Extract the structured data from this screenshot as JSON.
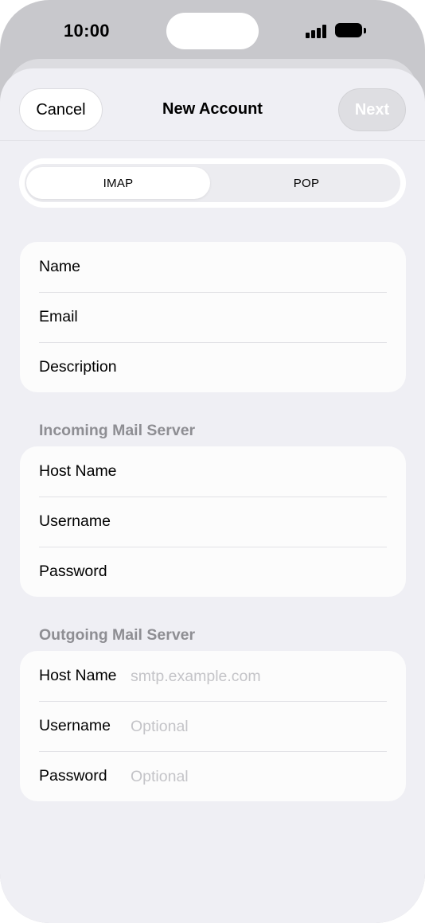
{
  "status_bar": {
    "time": "10:00"
  },
  "nav": {
    "cancel_label": "Cancel",
    "title": "New Account",
    "next_label": "Next"
  },
  "segmented": {
    "options": [
      "IMAP",
      "POP"
    ],
    "selected": "IMAP"
  },
  "account": {
    "rows": [
      {
        "label": "Name"
      },
      {
        "label": "Email"
      },
      {
        "label": "Description"
      }
    ]
  },
  "incoming": {
    "header": "Incoming Mail Server",
    "rows": [
      {
        "label": "Host Name"
      },
      {
        "label": "Username"
      },
      {
        "label": "Password"
      }
    ]
  },
  "outgoing": {
    "header": "Outgoing Mail Server",
    "rows": [
      {
        "label": "Host Name",
        "placeholder": "smtp.example.com"
      },
      {
        "label": "Username",
        "placeholder": "Optional"
      },
      {
        "label": "Password",
        "placeholder": "Optional"
      }
    ]
  },
  "colors": {
    "background": "#efeff4",
    "card": "#fcfcfc",
    "secondary_text": "#8e8e93",
    "placeholder": "#c4c4c8",
    "next_disabled": "#dedee2"
  }
}
